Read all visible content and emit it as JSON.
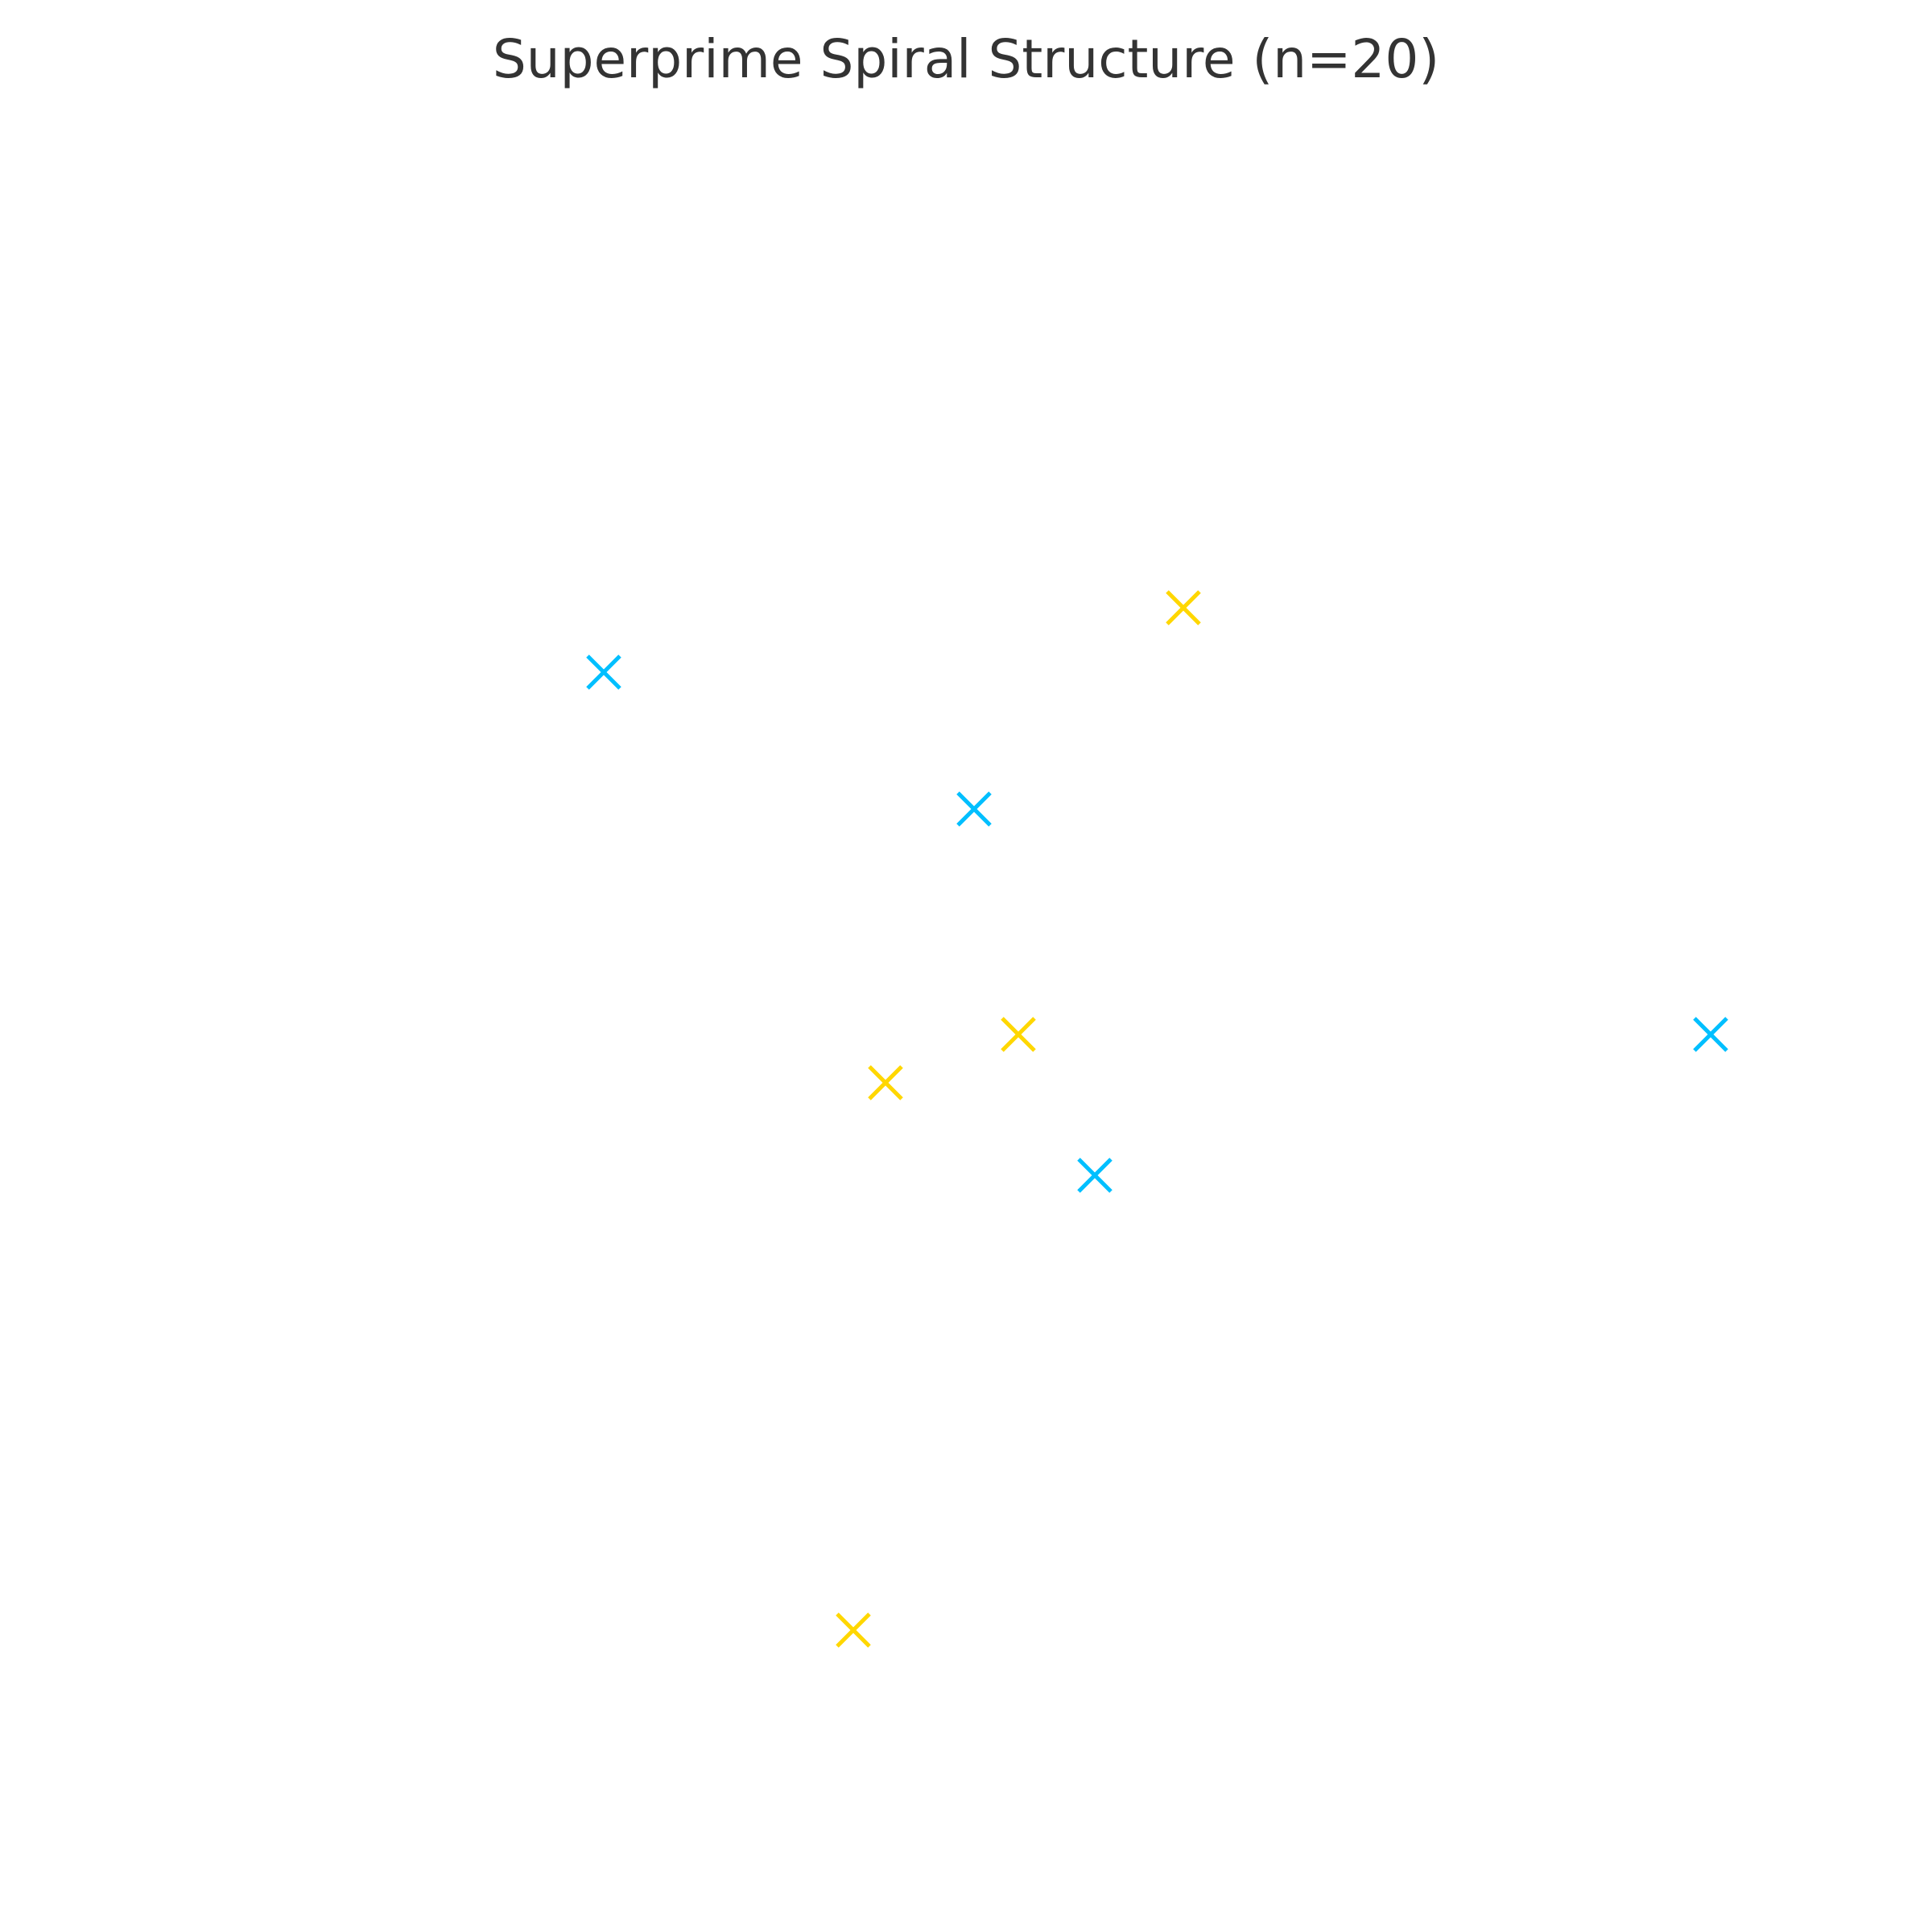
{
  "chart_data": {
    "type": "scatter",
    "title": "Superprime Spiral Structure (n=20)",
    "xlabel": "",
    "ylabel": "",
    "xlim": [
      -2.0,
      2.0
    ],
    "ylim": [
      -2.0,
      2.0
    ],
    "grid": false,
    "axes_visible": false,
    "marker": "x",
    "series": [
      {
        "color": "#00bfff",
        "points": [
          {
            "x": -1.0,
            "y": 0.9
          },
          {
            "x": -0.08,
            "y": 0.56
          },
          {
            "x": 0.22,
            "y": -0.35
          },
          {
            "x": 1.75,
            "y": 0.0
          }
        ]
      },
      {
        "color": "#ffd700",
        "points": [
          {
            "x": 0.44,
            "y": 1.06
          },
          {
            "x": 0.03,
            "y": 0.0
          },
          {
            "x": -0.3,
            "y": -0.12
          },
          {
            "x": -0.38,
            "y": -1.48
          }
        ]
      }
    ]
  }
}
